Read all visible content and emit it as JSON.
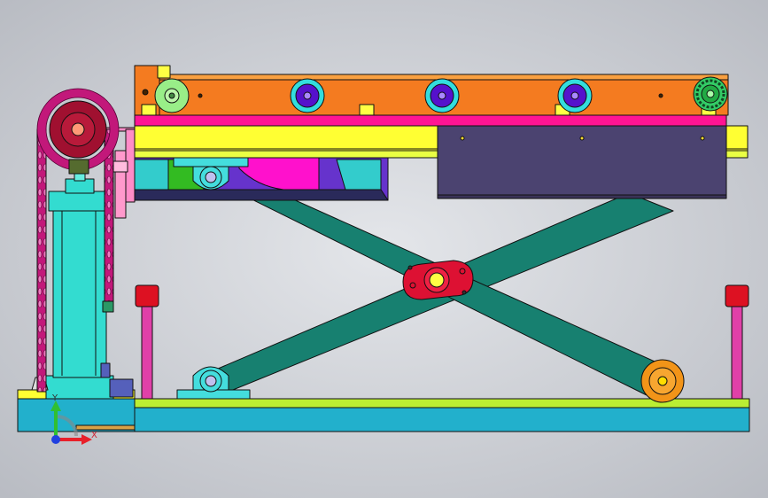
{
  "viewport": {
    "background_center": "#e4e6ea",
    "background_edge": "#b9bcc3"
  },
  "colors": {
    "conveyor_frame": "#f47b20",
    "conveyor_belt": "#ff1493",
    "platform_yellow": "#ffff33",
    "housing_dark": "#4b4370",
    "scissor_arm": "#178070",
    "pivot_bracket": "#dd1133",
    "cylinder_body": "#33dcd0",
    "sprocket": "#a01030",
    "chain": "#c2187a",
    "base_cyan": "#22b0cc",
    "base_lime": "#bbee33",
    "bumper_red": "#dd1122",
    "bumper_post": "#e040a8",
    "roller_lime": "#99ee88",
    "roller_purple": "#5511cc",
    "roller_cyan": "#33dddd",
    "lower_roller": "#f29418",
    "pillow_block": "#44dddd"
  },
  "components": [
    {
      "name": "conveyor-frame"
    },
    {
      "name": "conveyor-rollers",
      "count": 5
    },
    {
      "name": "lift-platform"
    },
    {
      "name": "drive-housing"
    },
    {
      "name": "scissor-arms",
      "count": 2
    },
    {
      "name": "center-pivot"
    },
    {
      "name": "hydraulic-cylinder"
    },
    {
      "name": "chain-sprocket"
    },
    {
      "name": "drive-chain"
    },
    {
      "name": "base-frame"
    },
    {
      "name": "stop-bumpers",
      "count": 2
    },
    {
      "name": "lower-roller"
    }
  ],
  "triad": {
    "x_label": "X",
    "y_label": "Y",
    "x_color": "#e8202a",
    "y_color": "#30c030",
    "z_color": "#2040e0"
  }
}
